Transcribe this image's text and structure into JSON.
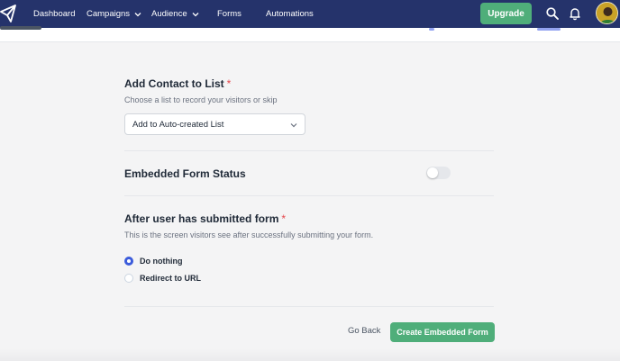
{
  "nav": {
    "items": [
      {
        "label": "Dashboard",
        "has_chevron": false
      },
      {
        "label": "Campaigns",
        "has_chevron": true
      },
      {
        "label": "Audience",
        "has_chevron": true
      },
      {
        "label": "Forms",
        "has_chevron": false
      },
      {
        "label": "Automations",
        "has_chevron": false
      }
    ],
    "upgrade_label": "Upgrade",
    "icons": [
      "paper-plane-logo-icon",
      "search-icon",
      "bell-icon",
      "avatar"
    ],
    "colors": {
      "bar": "#25336b",
      "accent": "#4fae7a"
    }
  },
  "contact_list": {
    "title": "Add Contact to List",
    "required_mark": "*",
    "help": "Choose a list to record your visitors or skip",
    "selected": "Add to Auto-created List"
  },
  "form_status": {
    "title": "Embedded Form Status",
    "enabled": false
  },
  "after_submit": {
    "title": "After user has submitted form",
    "required_mark": "*",
    "help": "This is the screen visitors see after successfully submitting your form.",
    "options": [
      {
        "label": "Do nothing",
        "checked": true
      },
      {
        "label": "Redirect to URL",
        "checked": false
      }
    ]
  },
  "actions": {
    "back_label": "Go Back",
    "create_label": "Create Embedded Form"
  }
}
